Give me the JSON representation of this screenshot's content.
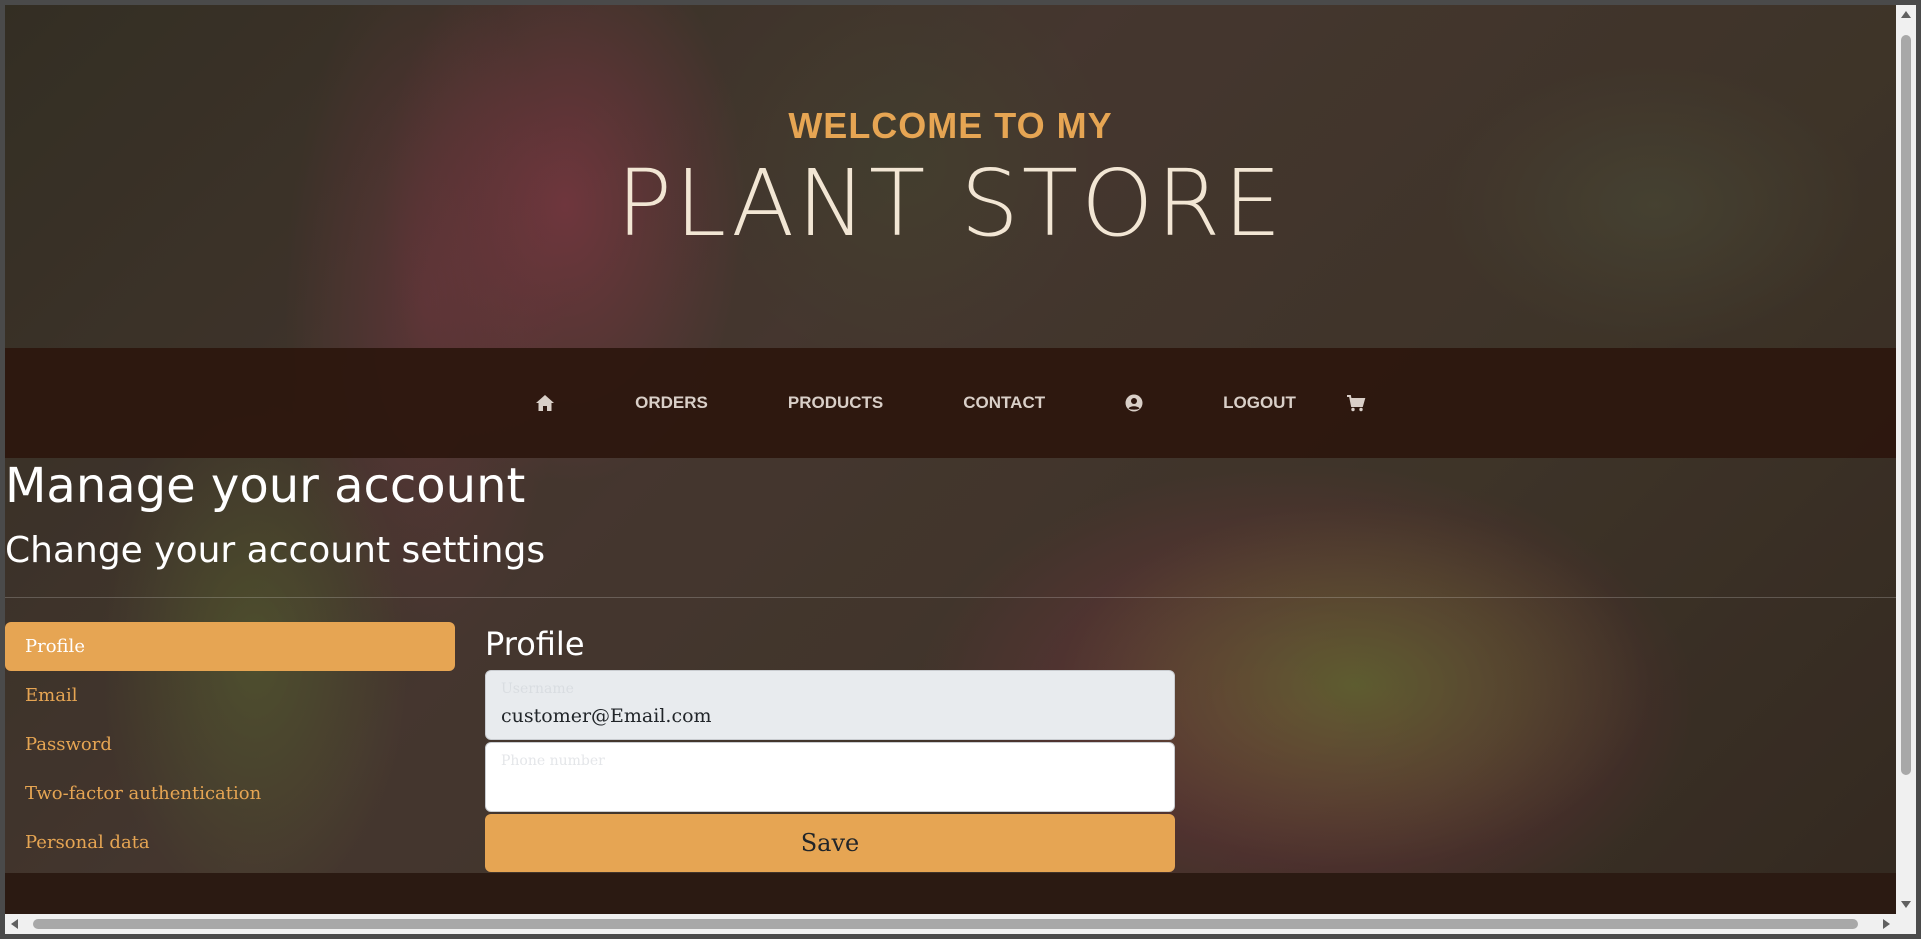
{
  "hero": {
    "subtitle": "WELCOME TO MY",
    "title": "PLANT STORE"
  },
  "nav": {
    "home_icon": "home-icon",
    "orders": "ORDERS",
    "products": "PRODUCTS",
    "contact": "CONTACT",
    "account_icon": "user-circle-icon",
    "logout": "LOGOUT",
    "cart_icon": "shopping-cart-icon"
  },
  "page": {
    "heading": "Manage your account",
    "subheading": "Change your account settings"
  },
  "sidebar": {
    "items": [
      {
        "label": "Profile",
        "active": true
      },
      {
        "label": "Email",
        "active": false
      },
      {
        "label": "Password",
        "active": false
      },
      {
        "label": "Two-factor authentication",
        "active": false
      },
      {
        "label": "Personal data",
        "active": false
      }
    ]
  },
  "profile_form": {
    "title": "Profile",
    "username_label": "Username",
    "username_value": "customer@Email.com",
    "phone_label": "Phone number",
    "phone_value": "",
    "save_label": "Save"
  },
  "colors": {
    "accent": "#e6a553",
    "nav_bg": "#2d160e",
    "hero_title": "#f2e6d4"
  }
}
